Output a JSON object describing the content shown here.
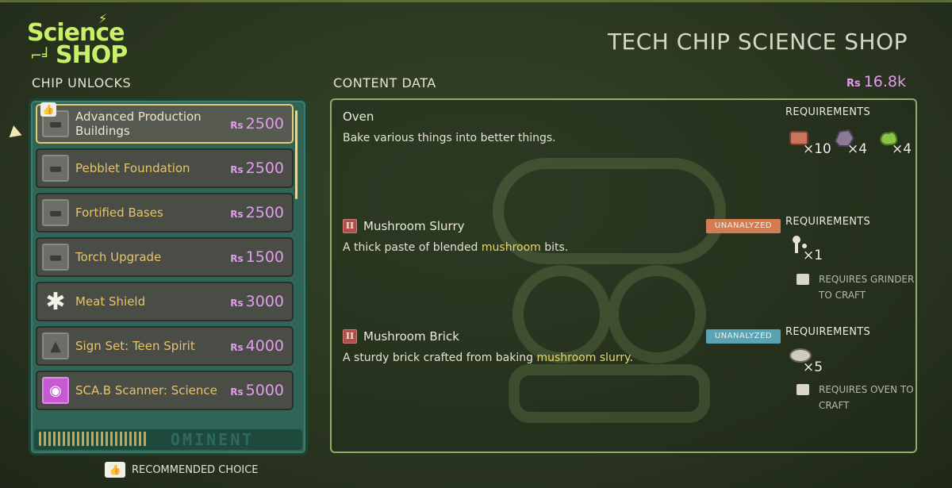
{
  "logo": {
    "line1": "Science",
    "line2": "SHOP"
  },
  "page_title": "TECH CHIP SCIENCE SHOP",
  "sections": {
    "chip_unlocks": "CHIP UNLOCKS",
    "content_data": "CONTENT DATA"
  },
  "currency": {
    "symbol": "Rs",
    "amount": "16.8k"
  },
  "chips": [
    {
      "name": "Advanced Production Buildings",
      "cost": "2500",
      "icon": "anvil-icon",
      "selected": true,
      "recommended": true
    },
    {
      "name": "Pebblet Foundation",
      "cost": "2500",
      "icon": "anvil-icon"
    },
    {
      "name": "Fortified Bases",
      "cost": "2500",
      "icon": "anvil-icon"
    },
    {
      "name": "Torch Upgrade",
      "cost": "1500",
      "icon": "anvil-icon"
    },
    {
      "name": "Meat Shield",
      "cost": "3000",
      "icon": "meat-shield-icon"
    },
    {
      "name": "Sign Set: Teen Spirit",
      "cost": "4000",
      "icon": "picture-icon"
    },
    {
      "name": "SCA.B Scanner: Science",
      "cost": "5000",
      "icon": "scanner-icon"
    }
  ],
  "chip_footer_brand": "OMINENT",
  "recommended_label": "RECOMMENDED CHOICE",
  "entries": [
    {
      "name": "Oven",
      "description": "Bake various things into better things.",
      "requirements_label": "REQUIREMENTS",
      "requirements": [
        {
          "icon": "brick-icon",
          "count": "×10"
        },
        {
          "icon": "rock-icon",
          "count": "×4"
        },
        {
          "icon": "moss-icon",
          "count": "×4"
        }
      ]
    },
    {
      "tier": "II",
      "name": "Mushroom Slurry",
      "status": "UNANALYZED",
      "desc_pre": "A thick paste of blended ",
      "desc_hl": "mushroom",
      "desc_post": " bits.",
      "requirements_label": "REQUIREMENTS",
      "requirements": [
        {
          "icon": "mushroom-icon",
          "count": "×1"
        }
      ],
      "note": "REQUIRES GRINDER TO CRAFT"
    },
    {
      "tier": "II",
      "name": "Mushroom Brick",
      "status": "UNANALYZED",
      "desc_pre": "A sturdy brick crafted from baking ",
      "desc_hl": "mushroom slurry",
      "desc_post": ".",
      "requirements_label": "REQUIREMENTS",
      "requirements": [
        {
          "icon": "slurry-icon",
          "count": "×5"
        }
      ],
      "note": "REQUIRES OVEN TO CRAFT"
    }
  ],
  "colors": {
    "accent_purple": "#e39bf0",
    "chip_name_yellow": "#e7c36a",
    "panel_teal": "#2e6556",
    "status_orange": "#d57b52",
    "status_blue": "#5aa3b4"
  }
}
